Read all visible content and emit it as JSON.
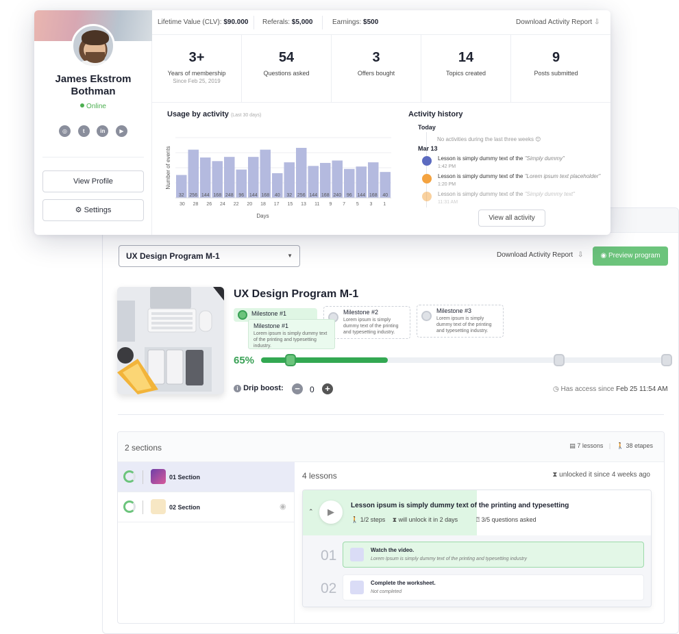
{
  "profile": {
    "name": "James Ekstrom Bothman",
    "status": "Online",
    "socials": [
      "instagram-icon",
      "twitter-icon",
      "linkedin-icon",
      "youtube-icon"
    ],
    "view_profile": "View Profile",
    "settings": "Settings"
  },
  "stats_bar": {
    "clv_label": "Lifetime Value (CLV):",
    "clv_value": "$90.000",
    "referrals_label": "Referals:",
    "referrals_value": "$5,000",
    "earnings_label": "Earnings:",
    "earnings_value": "$500",
    "download": "Download Activity Report"
  },
  "metrics": [
    {
      "value": "3+",
      "label": "Years of membership",
      "sub": "Since Feb 25, 2019"
    },
    {
      "value": "54",
      "label": "Questions asked"
    },
    {
      "value": "3",
      "label": "Offers bought"
    },
    {
      "value": "14",
      "label": "Topics created"
    },
    {
      "value": "9",
      "label": "Posts submitted"
    }
  ],
  "usage": {
    "title": "Usage by activity",
    "subtitle": "(Last 30 days)"
  },
  "chart_data": {
    "type": "bar",
    "title": "Usage by activity",
    "xlabel": "Days",
    "ylabel": "Number of events",
    "categories": [
      "30",
      "28",
      "26",
      "24",
      "22",
      "20",
      "18",
      "17",
      "15",
      "13",
      "11",
      "9",
      "7",
      "5",
      "3",
      "1"
    ],
    "values": [
      32,
      256,
      144,
      168,
      248,
      96,
      144,
      168,
      40,
      32,
      256,
      144,
      168,
      240,
      96,
      144,
      168,
      40
    ],
    "bar_labels": [
      "32",
      "256",
      "144",
      "168",
      "248",
      "96",
      "144",
      "168",
      "40",
      "32",
      "256",
      "144",
      "168",
      "240",
      "96",
      "144",
      "168",
      "40"
    ],
    "heights": [
      0.38,
      0.8,
      0.67,
      0.61,
      0.68,
      0.47,
      0.68,
      0.8,
      0.41,
      0.59,
      0.83,
      0.53,
      0.58,
      0.62,
      0.48,
      0.52,
      0.59,
      0.43
    ],
    "color": "#b4badf"
  },
  "history": {
    "title": "Activity history",
    "today": "Today",
    "empty": "No activities during the last three weeks 😊",
    "date": "Mar 13",
    "items": [
      {
        "text": "Lesson is simply dummy text of the ",
        "ref": "\"Simply dummy\"",
        "time": "1:42 PM",
        "color": "#5c6bc0"
      },
      {
        "text": "Lesson is simply dummy text of the ",
        "ref": "\"Lorem ipsum text placeholder\"",
        "time": "1:20 PM",
        "color": "#f4a340"
      },
      {
        "text": "Lesson is simply dummy text of the ",
        "ref": "\"Simply dummy text\"",
        "time": "11:31 AM",
        "color": "#f4a340"
      }
    ],
    "view_all": "View all activity"
  },
  "program": {
    "select_value": "UX Design Program M-1",
    "download": "Download Activity Report",
    "preview": "Preview program",
    "title": "UX Design Program M-1",
    "progress_pct": "65%",
    "progress": 0.31,
    "milestones": [
      {
        "name": "Milestone #1"
      },
      {
        "name": "Milestone #2",
        "desc": "Lorem ipsum is simply dummy text of the printing and typesetting industry."
      },
      {
        "name": "Milestone #3",
        "desc": "Lorem ipsum is simply dummy text of the printing and typesetting industry."
      }
    ],
    "tooltip": {
      "name": "Milestone #1",
      "desc": "Lorem ipsum is simply dummy text of the printing and typesetting industry."
    },
    "drip_label": "Drip boost:",
    "drip_value": "0",
    "access_label": "Has access since",
    "access_date": "Feb 25 11:54 AM"
  },
  "sections": {
    "title": "2 sections",
    "lessons_count": "7 lessons",
    "etapes_count": "38 etapes",
    "items": [
      {
        "name": "01 Section"
      },
      {
        "name": "02 Section"
      }
    ],
    "lessons_title": "4 lessons",
    "unlocked": "unlocked it since 4 weeks ago",
    "lesson": {
      "title": "Lesson ipsum is simply dummy text of the printing and typesetting",
      "steps": "1/2 steps",
      "unlock": "will unlock it in 2 days",
      "questions": "3/5 questions asked"
    },
    "steps": [
      {
        "num": "01",
        "title": "Watch the video.",
        "sub": "Lorem Ipsum is simply dummy text of the printing and typesetting industry"
      },
      {
        "num": "02",
        "title": "Complete the worksheet.",
        "sub": "Not completed"
      }
    ]
  }
}
